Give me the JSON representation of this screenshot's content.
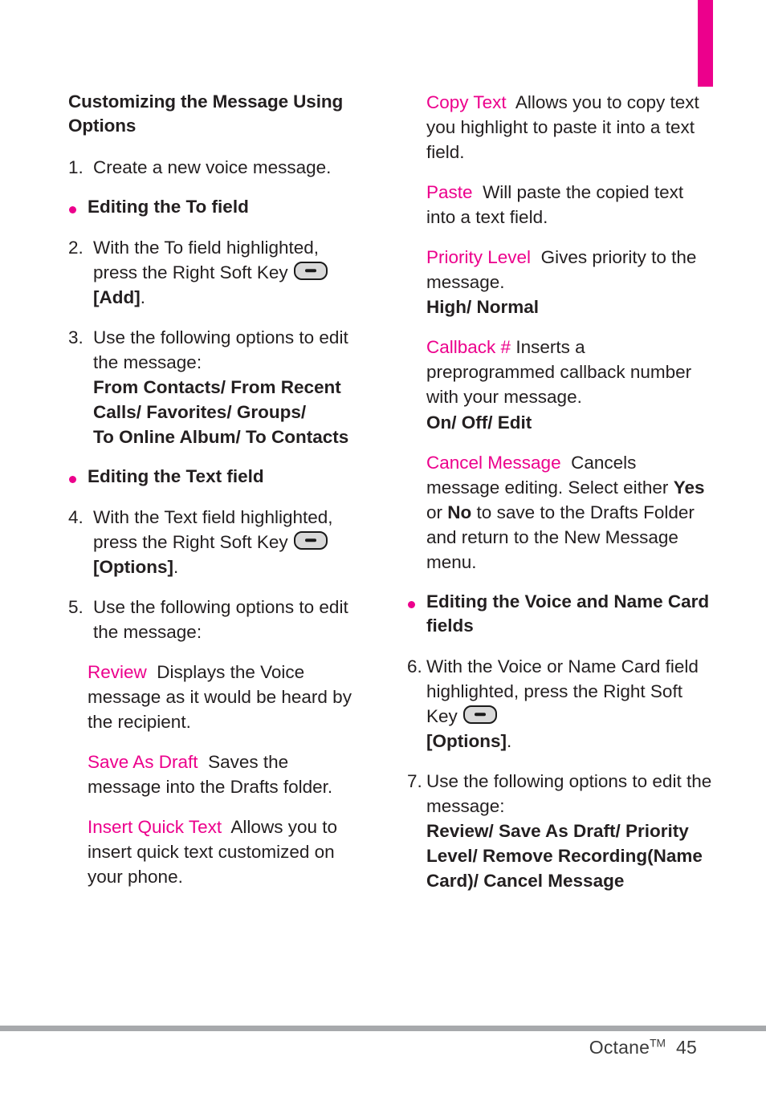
{
  "page": {
    "number": "45",
    "product": "Octane",
    "trademark": "TM",
    "accent_color": "#EC008C",
    "rule_color": "#a7a9ac"
  },
  "tab_marker": {
    "name": "section-tab",
    "color": "#EC008C"
  },
  "left_column": {
    "heading": "Customizing the Message Using Options",
    "step1": {
      "num": "1.",
      "text": "Create a new voice message."
    },
    "bullet1": "Editing the To field",
    "step2": {
      "num": "2.",
      "text_before": "With the To field highlighted, press the Right Soft Key",
      "text_after_bold": "[Add]",
      "text_end": "."
    },
    "step3": {
      "num": "3.",
      "text": "Use the following options to edit the message:",
      "options_bold": "From Contacts/ From Recent Calls/ Favorites/ Groups/ To Online Album/ To Contacts",
      "options_line1": "From Contacts/ From Recent",
      "options_line2": "Calls/ Favorites/ Groups/",
      "options_line3": "To Online Album/ To Contacts"
    },
    "bullet2": "Editing the Text field",
    "step4": {
      "num": "4.",
      "text_before": "With the Text field highlighted, press the Right Soft Key",
      "text_after_bold": "[Options]",
      "text_end": "."
    },
    "step5": {
      "num": "5.",
      "text": "Use the following options to edit the message:"
    },
    "options": [
      {
        "term": "Review",
        "desc": "Displays the Voice message as it would be heard by the recipient."
      },
      {
        "term": "Save As Draft",
        "desc": "Saves the message into the Drafts folder."
      },
      {
        "term": "Insert Quick Text",
        "desc": "Allows you to insert quick text customized on your phone."
      }
    ]
  },
  "right_column": {
    "options": [
      {
        "term": "Copy Text",
        "desc": "Allows you to copy text you highlight to paste it into a text field.",
        "values": ""
      },
      {
        "term": "Paste",
        "desc": "Will paste the copied text into a text field.",
        "values": ""
      },
      {
        "term": "Priority Level",
        "desc": "Gives priority to the message.",
        "values": "High/ Normal"
      },
      {
        "term": "Callback #",
        "desc": "Inserts a preprogrammed callback number with your message.",
        "values": "On/ Off/ Edit"
      }
    ],
    "cancel_message": {
      "term": "Cancel Message",
      "desc_part1": "Cancels message editing. Select either",
      "yes": "Yes",
      "or": "or",
      "no": "No",
      "desc_part2": "to save to the Drafts Folder and return to the New Message menu."
    },
    "bullet3": "Editing the Voice and Name Card fields",
    "step6": {
      "num": "6.",
      "text_before": "With the Voice or Name Card field highlighted, press the Right Soft Key",
      "text_after_bold": "[Options]",
      "text_end": "."
    },
    "step7": {
      "num": "7.",
      "text": "Use the following options to edit the message:",
      "options_bold": "Review/ Save As Draft/ Priority Level/ Remove Recording(Name Card)/ Cancel Message",
      "options_line1": "Review/ Save As Draft/ Priority",
      "options_line2": "Level/ Remove Recording(Name",
      "options_line3": "Card)/ Cancel Message"
    }
  }
}
